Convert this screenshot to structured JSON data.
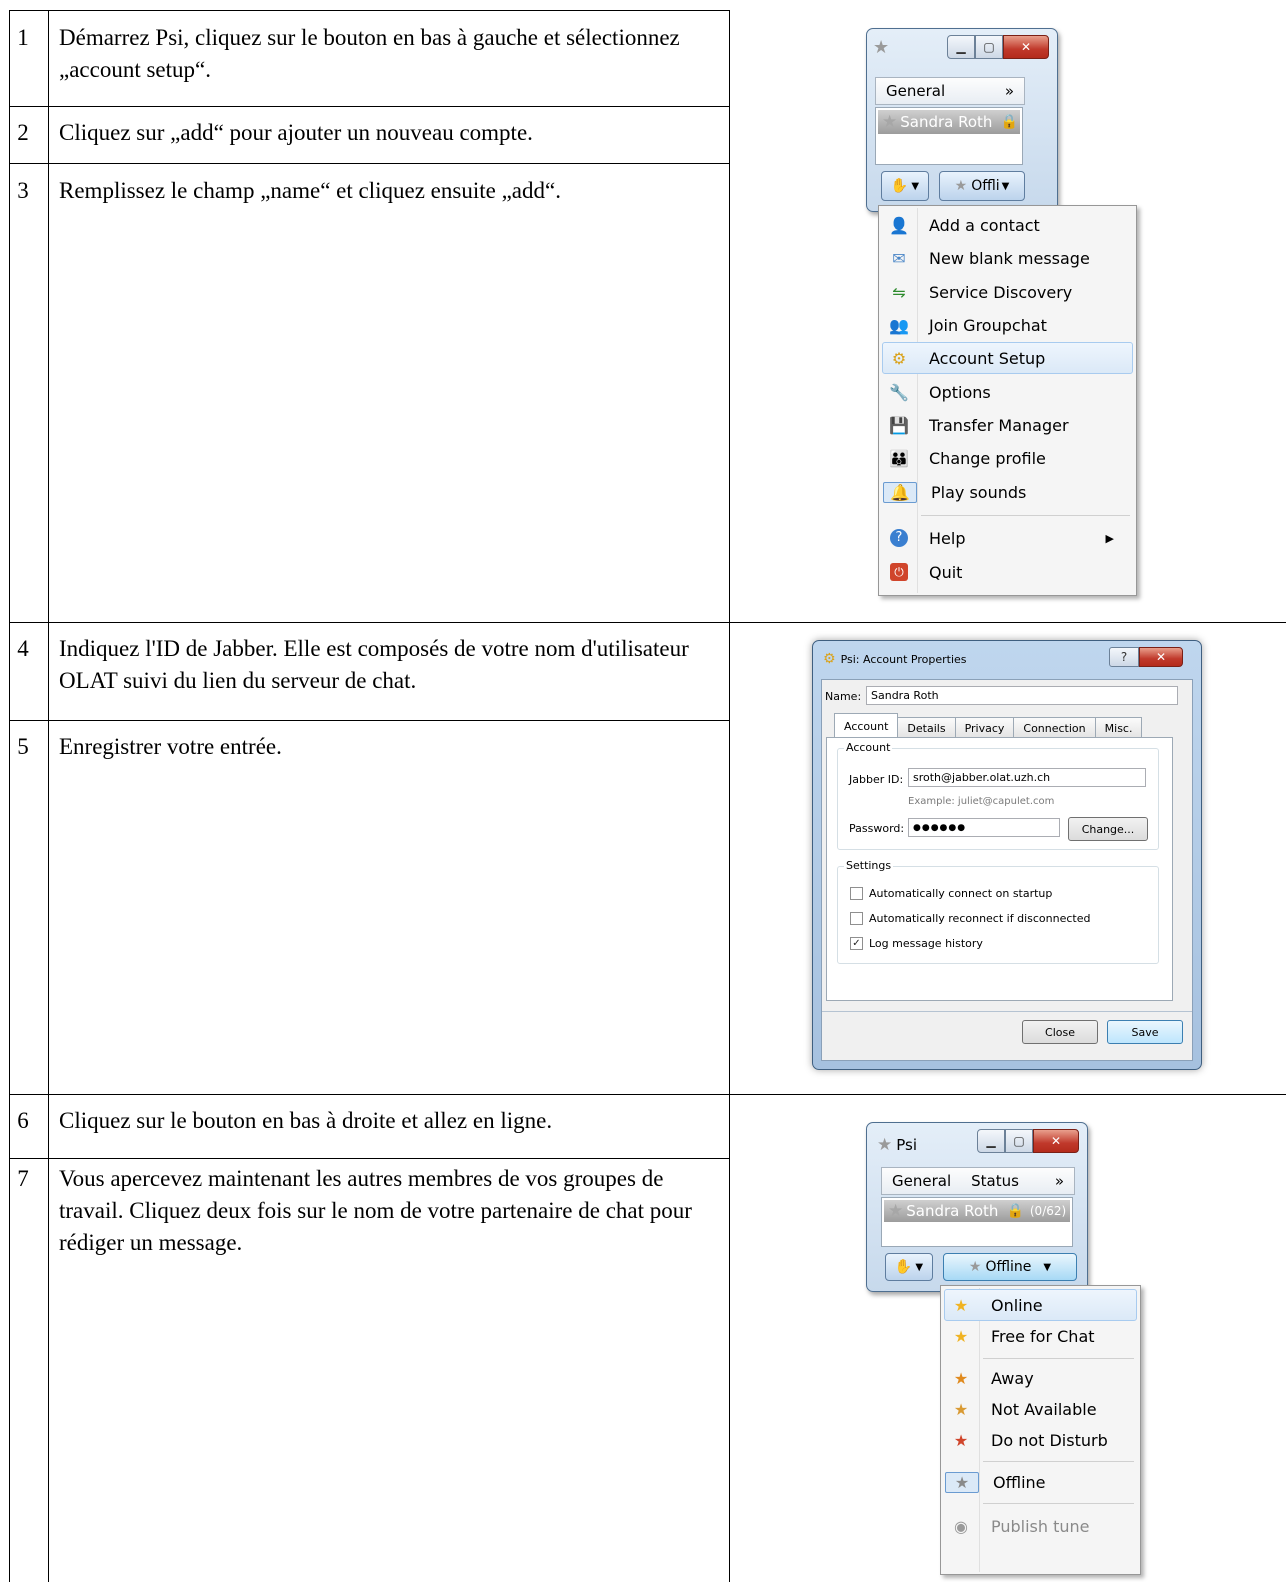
{
  "steps": [
    {
      "num": "1",
      "text": "Démarrez Psi, cliquez sur le bouton en bas à gauche et sélectionnez „account setup“."
    },
    {
      "num": "2",
      "text": "Cliquez sur „add“ pour ajouter un nouveau compte."
    },
    {
      "num": "3",
      "text": "Remplissez le champ „name“ et cliquez ensuite „add“."
    },
    {
      "num": "4",
      "text": "Indiquez l'ID de Jabber. Elle est composés de votre nom d'utilisateur OLAT suivi du lien du serveur de chat."
    },
    {
      "num": "5",
      "text": "Enregistrer votre entrée."
    },
    {
      "num": "6",
      "text": "Cliquez sur le bouton en bas à droite et allez en ligne."
    },
    {
      "num": "7",
      "text": "Vous apercevez maintenant les autres membres de vos groupes de travail. Cliquez deux fois sur le nom de votre partenaire de chat pour rédiger un message."
    }
  ],
  "shot1": {
    "tab_general": "General",
    "tab_more": "»",
    "account_name": "Sandra Roth",
    "status_btn": "Offli",
    "menu": [
      {
        "icon": "add-contact-icon",
        "glyph": "👤",
        "label": "Add a contact"
      },
      {
        "icon": "envelope-icon",
        "glyph": "✉",
        "label": "New blank message"
      },
      {
        "icon": "service-discovery-icon",
        "glyph": "⇋",
        "label": "Service Discovery"
      },
      {
        "icon": "groupchat-icon",
        "glyph": "👥",
        "label": "Join Groupchat"
      },
      {
        "icon": "account-setup-icon",
        "glyph": "⚙",
        "label": "Account Setup"
      },
      {
        "icon": "wrench-icon",
        "glyph": "🔧",
        "label": "Options"
      },
      {
        "icon": "floppy-icon",
        "glyph": "💾",
        "label": "Transfer Manager"
      },
      {
        "icon": "profile-icon",
        "glyph": "👪",
        "label": "Change profile"
      },
      {
        "icon": "sound-icon",
        "glyph": "🔔",
        "label": "Play sounds"
      },
      {
        "icon": "help-icon",
        "glyph": "?",
        "label": "Help"
      },
      {
        "icon": "quit-icon",
        "glyph": "⏻",
        "label": "Quit"
      }
    ]
  },
  "dialog": {
    "title": "Psi: Account Properties",
    "name_label": "Name:",
    "name_value": "Sandra Roth",
    "tabs": [
      "Account",
      "Details",
      "Privacy",
      "Connection",
      "Misc."
    ],
    "group_account": "Account",
    "jid_label": "Jabber ID:",
    "jid_value": "sroth@jabber.olat.uzh.ch",
    "example": "Example: juliet@capulet.com",
    "password_label": "Password:",
    "password_value": "●●●●●●",
    "change_btn": "Change...",
    "group_settings": "Settings",
    "checkboxes": [
      {
        "label": "Automatically connect on startup",
        "checked": false
      },
      {
        "label": "Automatically reconnect if disconnected",
        "checked": false
      },
      {
        "label": "Log message history",
        "checked": true
      }
    ],
    "close_btn": "Close",
    "save_btn": "Save"
  },
  "shot3": {
    "title": "Psi",
    "tab_general": "General",
    "tab_status": "Status",
    "tab_more": "»",
    "account_name": "Sandra Roth",
    "account_count": "(0/62)",
    "status_btn": "Offline",
    "menu": [
      {
        "icon": "online-icon",
        "glyph": "★",
        "label": "Online"
      },
      {
        "icon": "free-for-chat-icon",
        "glyph": "★",
        "label": "Free for Chat"
      },
      {
        "icon": "away-icon",
        "glyph": "★",
        "label": "Away"
      },
      {
        "icon": "not-available-icon",
        "glyph": "★",
        "label": "Not Available"
      },
      {
        "icon": "do-not-disturb-icon",
        "glyph": "★",
        "label": "Do not Disturb"
      },
      {
        "icon": "offline-icon",
        "glyph": "★",
        "label": "Offline"
      },
      {
        "icon": "publish-tune-icon",
        "glyph": "◉",
        "label": "Publish tune"
      }
    ]
  }
}
